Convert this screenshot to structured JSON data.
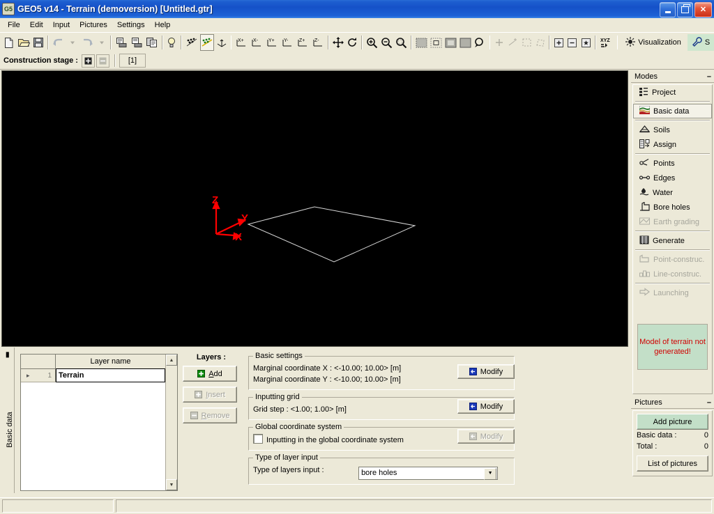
{
  "window": {
    "title": "GEO5 v14 - Terrain (demoversion) [Untitled.gtr]",
    "icon": "geo5-app-icon",
    "minimize": "minimize-button",
    "restore": "restore-button",
    "close": "close-button"
  },
  "menu": {
    "items": [
      {
        "label": "File"
      },
      {
        "label": "Edit"
      },
      {
        "label": "Input"
      },
      {
        "label": "Pictures"
      },
      {
        "label": "Settings"
      },
      {
        "label": "Help"
      }
    ]
  },
  "toolbar": {
    "groups": [
      {
        "buttons": [
          {
            "name": "new-file-icon",
            "glyph": "new"
          },
          {
            "name": "open-file-icon",
            "glyph": "open"
          },
          {
            "name": "save-file-icon",
            "glyph": "save"
          }
        ]
      },
      {
        "buttons": [
          {
            "name": "undo-icon",
            "glyph": "undo",
            "disabled": true
          },
          {
            "name": "undo-dropdown-icon",
            "glyph": "caret",
            "disabled": true
          },
          {
            "name": "redo-icon",
            "glyph": "redo",
            "disabled": true
          },
          {
            "name": "redo-dropdown-icon",
            "glyph": "caret",
            "disabled": true
          }
        ]
      },
      {
        "buttons": [
          {
            "name": "print-icon",
            "glyph": "print"
          },
          {
            "name": "print-preview-icon",
            "glyph": "print2"
          },
          {
            "name": "copy-icon",
            "glyph": "copy"
          }
        ]
      },
      {
        "buttons": [
          {
            "name": "hint-bulb-icon",
            "glyph": "bulb"
          }
        ]
      },
      {
        "buttons": [
          {
            "name": "view-points-icon",
            "glyph": "pts1"
          },
          {
            "name": "view-points-selected-icon",
            "glyph": "pts2",
            "pressed": true
          },
          {
            "name": "view-axes-icon",
            "glyph": "axes"
          }
        ]
      },
      {
        "buttons": [
          {
            "name": "rotate-x-plus-icon",
            "glyph": "xp"
          },
          {
            "name": "rotate-x-minus-icon",
            "glyph": "xm"
          },
          {
            "name": "rotate-y-plus-icon",
            "glyph": "yp"
          },
          {
            "name": "rotate-y-minus-icon",
            "glyph": "ym"
          },
          {
            "name": "rotate-z-plus-icon",
            "glyph": "zp"
          },
          {
            "name": "rotate-z-minus-icon",
            "glyph": "zm"
          }
        ]
      },
      {
        "buttons": [
          {
            "name": "pan-icon",
            "glyph": "pan"
          },
          {
            "name": "rotate-free-icon",
            "glyph": "hand"
          }
        ]
      },
      {
        "buttons": [
          {
            "name": "zoom-in-icon",
            "glyph": "zin"
          },
          {
            "name": "zoom-out-icon",
            "glyph": "zout"
          },
          {
            "name": "zoom-window-icon",
            "glyph": "zwin"
          }
        ]
      },
      {
        "buttons": [
          {
            "name": "view-all-icon",
            "glyph": "vall"
          },
          {
            "name": "view-fit-icon",
            "glyph": "vfit"
          },
          {
            "name": "view-previous-icon",
            "glyph": "vprev"
          },
          {
            "name": "view-region-icon",
            "glyph": "vreg"
          },
          {
            "name": "zoom-selection-icon",
            "glyph": "zsel"
          }
        ]
      },
      {
        "buttons": [
          {
            "name": "add-point-icon",
            "glyph": "plus",
            "disabled": true
          },
          {
            "name": "add-points-icon",
            "glyph": "plus2",
            "disabled": true
          },
          {
            "name": "select-rect-icon",
            "glyph": "selrect",
            "disabled": true
          },
          {
            "name": "select-poly-icon",
            "glyph": "selpoly",
            "disabled": true
          }
        ]
      },
      {
        "buttons": [
          {
            "name": "grid-add-icon",
            "glyph": "gadd"
          },
          {
            "name": "grid-remove-icon",
            "glyph": "grem"
          },
          {
            "name": "grid-star-icon",
            "glyph": "gstar"
          }
        ]
      },
      {
        "buttons": [
          {
            "name": "xyz-coordinates-icon",
            "glyph": "xyz"
          }
        ]
      }
    ],
    "visualization": {
      "label": "Visualization",
      "icon": "visualization-icon"
    },
    "settings_cut": {
      "label": "S",
      "icon": "wrench-icon"
    }
  },
  "stage": {
    "label": "Construction stage :",
    "add_icon": "stage-add-icon",
    "remove_icon": "stage-remove-icon",
    "tabs": [
      {
        "label": "[1]",
        "active": true
      }
    ]
  },
  "viewport": {
    "axes": [
      {
        "name": "z-axis-label",
        "label": "Z"
      },
      {
        "name": "y-axis-label",
        "label": "Y"
      },
      {
        "name": "x-axis-label",
        "label": "X"
      }
    ],
    "axis_color": "#ff0000",
    "wireframe_color": "#d8d8d8",
    "background": "#000000"
  },
  "bottom": {
    "vertical_tab": "Basic data",
    "table": {
      "headers": [
        "",
        "Layer name"
      ],
      "rows": [
        {
          "index": "1",
          "name": "Terrain"
        }
      ]
    },
    "layers": {
      "title": "Layers :",
      "buttons": [
        {
          "label": "Add",
          "icon": "add-plus-icon",
          "disabled": false
        },
        {
          "label": "Insert",
          "icon": "insert-icon",
          "disabled": true
        },
        {
          "label": "Remove",
          "icon": "remove-minus-icon",
          "disabled": true
        }
      ]
    },
    "basic_settings": {
      "legend": "Basic settings",
      "row_x": "Marginal coordinate X : <-10.00; 10.00> [m]",
      "row_y": "Marginal coordinate Y : <-10.00; 10.00> [m]",
      "modify": "Modify"
    },
    "inputting_grid": {
      "legend": "Inputting grid",
      "row": "Grid step : <1.00; 1.00> [m]",
      "modify": "Modify"
    },
    "global_cs": {
      "legend": "Global coordinate system",
      "checkbox_label": "Inputting in the global coordinate system",
      "checked": false,
      "modify": "Modify",
      "modify_disabled": true
    },
    "layer_input": {
      "legend": "Type of layer input",
      "label": "Type of layers input :",
      "value": "bore holes"
    }
  },
  "sidebar": {
    "modes": {
      "title": "Modes",
      "minimize": "–",
      "items": [
        {
          "label": "Project",
          "icon": "project-icon",
          "selected": false,
          "disabled": false
        },
        {
          "label": "Basic data",
          "icon": "basic-data-icon",
          "selected": true,
          "disabled": false
        },
        {
          "label": "Soils",
          "icon": "soils-icon",
          "selected": false,
          "disabled": false
        },
        {
          "label": "Assign",
          "icon": "assign-icon",
          "selected": false,
          "disabled": false
        },
        {
          "label": "Points",
          "icon": "points-icon",
          "selected": false,
          "disabled": false
        },
        {
          "label": "Edges",
          "icon": "edges-icon",
          "selected": false,
          "disabled": false
        },
        {
          "label": "Water",
          "icon": "water-icon",
          "selected": false,
          "disabled": false
        },
        {
          "label": "Bore holes",
          "icon": "bore-holes-icon",
          "selected": false,
          "disabled": false
        },
        {
          "label": "Earth grading",
          "icon": "earth-grading-icon",
          "selected": false,
          "disabled": true
        },
        {
          "label": "Generate",
          "icon": "generate-icon",
          "selected": false,
          "disabled": false
        },
        {
          "label": "Point-construc.",
          "icon": "point-construc-icon",
          "selected": false,
          "disabled": true
        },
        {
          "label": "Line-construc.",
          "icon": "line-construc-icon",
          "selected": false,
          "disabled": true
        },
        {
          "label": "Launching",
          "icon": "launching-icon",
          "selected": false,
          "disabled": true
        }
      ],
      "notice": "Model of terrain not generated!",
      "notice_color": "#d00000",
      "notice_background": "#c3dfc8"
    },
    "pictures": {
      "title": "Pictures",
      "minimize": "–",
      "add_picture": "Add picture",
      "rows": [
        {
          "label": "Basic data :",
          "value": "0"
        },
        {
          "label": "Total :",
          "value": "0"
        }
      ],
      "list_button": "List of pictures"
    }
  },
  "statusbar": {
    "pane1": "",
    "pane2": ""
  }
}
